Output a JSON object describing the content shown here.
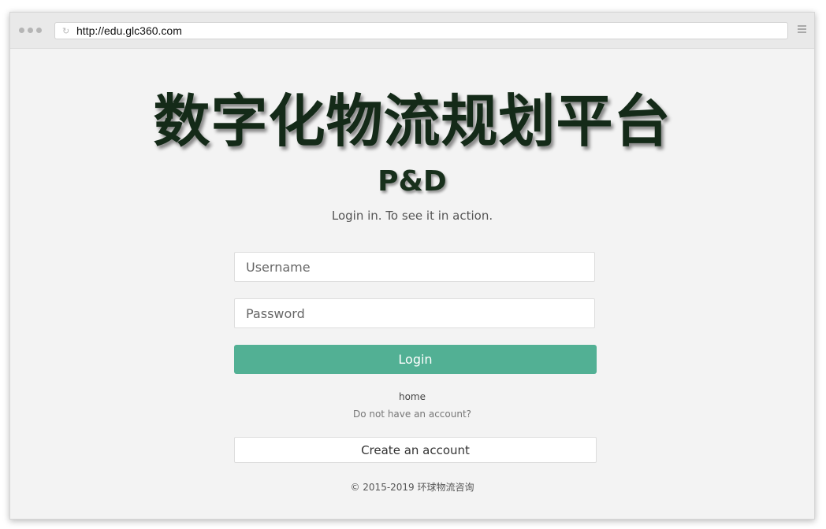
{
  "browser": {
    "url": "http://edu.glc360.com",
    "icons": {
      "window_controls": "traffic-light-dots",
      "reload": "reload-icon",
      "menu": "hamburger-menu-icon"
    }
  },
  "page": {
    "title": "数字化物流规划平台",
    "logo_text": "P&D",
    "subtitle": "Login in. To see it in action.",
    "username_placeholder": "Username",
    "password_placeholder": "Password",
    "login_label": "Login",
    "home_link": "home",
    "no_account_text": "Do not have an account?",
    "create_account_label": "Create an account",
    "copyright": "© 2015-2019 环球物流咨询"
  },
  "colors": {
    "primary_button": "#52b094",
    "title_text": "#142a18",
    "background": "#f3f3f3"
  }
}
